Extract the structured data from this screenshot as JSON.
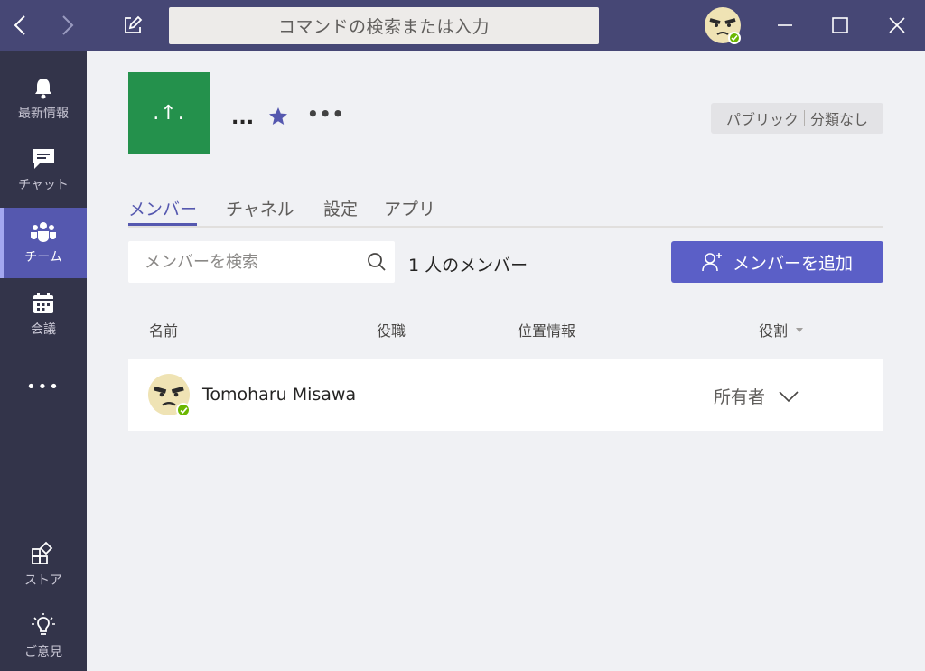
{
  "search": {
    "placeholder": "コマンドの検索または入力"
  },
  "rail": {
    "items": [
      {
        "label": "最新情報"
      },
      {
        "label": "チャット"
      },
      {
        "label": "チーム"
      },
      {
        "label": "会議"
      }
    ],
    "more_label": "•••",
    "bottom": [
      {
        "label": "ストア"
      },
      {
        "label": "ご意見"
      }
    ]
  },
  "team": {
    "logo_text": ".↑.",
    "name": "...",
    "more": "•••",
    "privacy": "パブリック",
    "classification": "分類なし"
  },
  "tabs": [
    "メンバー",
    "チャネル",
    "設定",
    "アプリ"
  ],
  "members": {
    "search_placeholder": "メンバーを検索",
    "count_label": "1 人のメンバー",
    "add_button": "メンバーを追加",
    "columns": {
      "name": "名前",
      "title": "役職",
      "location": "位置情報",
      "role": "役割"
    },
    "rows": [
      {
        "name": "Tomoharu Misawa",
        "role": "所有者"
      }
    ]
  },
  "colors": {
    "titlebar": "#464775",
    "rail": "#33344a",
    "accent": "#5b5fc7",
    "team_logo": "#24914c",
    "presence": "#6bb700"
  }
}
